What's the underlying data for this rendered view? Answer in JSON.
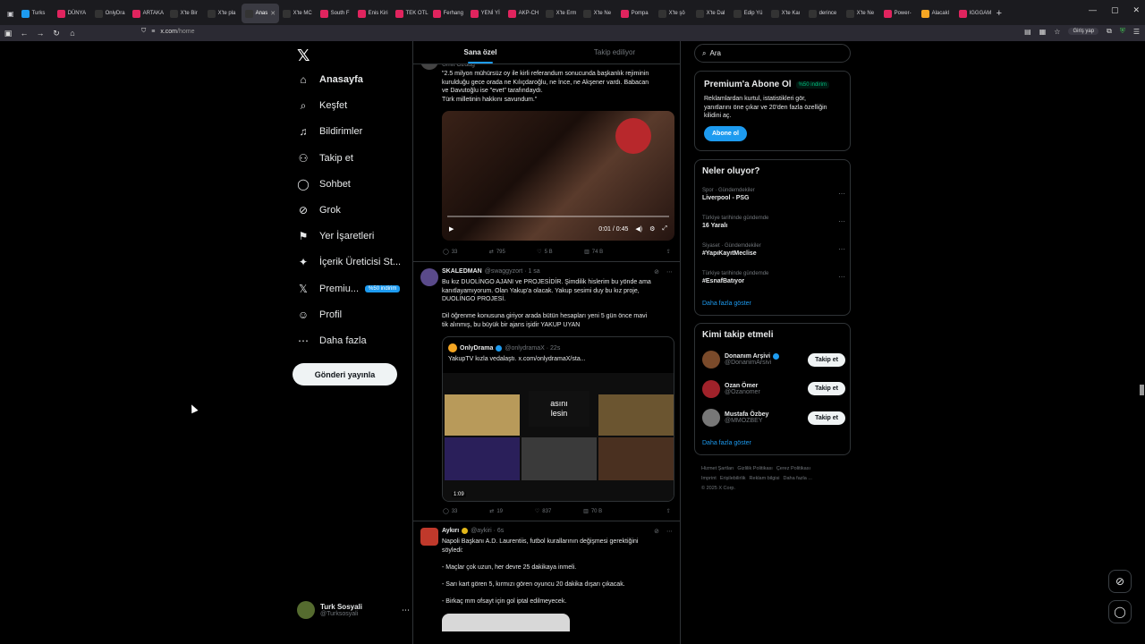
{
  "browser": {
    "tabs": [
      {
        "label": "Turks",
        "color": "#1d9bf0",
        "active": false
      },
      {
        "label": "DÜNYA",
        "color": "#e0245e",
        "active": false
      },
      {
        "label": "OnlyDra",
        "color": "#333",
        "active": false
      },
      {
        "label": "ARTAKA",
        "color": "#e0245e",
        "active": false
      },
      {
        "label": "X'te Bir",
        "color": "#333",
        "active": false
      },
      {
        "label": "X'te pla",
        "color": "#333",
        "active": false
      },
      {
        "label": "Anas",
        "color": "#333",
        "active": true
      },
      {
        "label": "X'te MC",
        "color": "#333",
        "active": false
      },
      {
        "label": "South F",
        "color": "#e0245e",
        "active": false
      },
      {
        "label": "Enis Kiri",
        "color": "#e0245e",
        "active": false
      },
      {
        "label": "TEK OTL",
        "color": "#e0245e",
        "active": false
      },
      {
        "label": "Ferhang",
        "color": "#e0245e",
        "active": false
      },
      {
        "label": "YENİ Yİ",
        "color": "#e0245e",
        "active": false
      },
      {
        "label": "AKP-CH",
        "color": "#e0245e",
        "active": false
      },
      {
        "label": "X'te Erm",
        "color": "#333",
        "active": false
      },
      {
        "label": "X'te Ne",
        "color": "#333",
        "active": false
      },
      {
        "label": "Pompa",
        "color": "#e0245e",
        "active": false
      },
      {
        "label": "X'te şö",
        "color": "#333",
        "active": false
      },
      {
        "label": "X'te Dal",
        "color": "#333",
        "active": false
      },
      {
        "label": "Edip Yü",
        "color": "#333",
        "active": false
      },
      {
        "label": "X'te Kaı",
        "color": "#333",
        "active": false
      },
      {
        "label": "derince",
        "color": "#333",
        "active": false
      },
      {
        "label": "X'te Ne",
        "color": "#333",
        "active": false
      },
      {
        "label": "Power-",
        "color": "#e0245e",
        "active": false
      },
      {
        "label": "Alacakl",
        "color": "#f5a623",
        "active": false
      },
      {
        "label": "IGGGAM",
        "color": "#e0245e",
        "active": false
      }
    ],
    "url_domain": "x.com",
    "url_path": "/home",
    "signin_label": "Giriş yap"
  },
  "nav": {
    "items": [
      {
        "label": "Anasayfa",
        "icon": "home-icon",
        "glyph": "⌂",
        "bold": true
      },
      {
        "label": "Keşfet",
        "icon": "search-icon",
        "glyph": "⌕",
        "bold": false
      },
      {
        "label": "Bildirimler",
        "icon": "bell-icon",
        "glyph": "♫",
        "bold": false
      },
      {
        "label": "Takip et",
        "icon": "follow-icon",
        "glyph": "⚇",
        "bold": false
      },
      {
        "label": "Sohbet",
        "icon": "chat-icon",
        "glyph": "◯",
        "bold": false
      },
      {
        "label": "Grok",
        "icon": "grok-icon",
        "glyph": "⊘",
        "bold": false
      },
      {
        "label": "Yer İşaretleri",
        "icon": "bookmark-icon",
        "glyph": "⚑",
        "bold": false
      },
      {
        "label": "İçerik Üreticisi St...",
        "icon": "lightning-icon",
        "glyph": "✦",
        "bold": false
      },
      {
        "label": "Premiu...",
        "icon": "x-icon",
        "glyph": "𝕏",
        "bold": false
      },
      {
        "label": "Profil",
        "icon": "profile-icon",
        "glyph": "☺",
        "bold": false
      },
      {
        "label": "Daha fazla",
        "icon": "more-icon",
        "glyph": "⋯",
        "bold": false
      }
    ],
    "premium_badge": "%50 indirim",
    "post_button": "Gönderi yayınla",
    "profile_name": "Turk Sosyali",
    "profile_handle": "@Turksosyali"
  },
  "feed": {
    "tabs": [
      "Sana özel",
      "Takip ediliyor"
    ],
    "tweet1": {
      "author_partial": "Ümit Özdağ",
      "text_lines": [
        "\"2.5 milyon mühürsüz oy ile kirli referandum sonucunda başkanlık rejiminin",
        "kurulduğu  gece orada ne Kılıçdaroğlu, ne İnce, ne Akşener vardı. Babacan",
        "ve Davutoğlu ise \"evet\" tarafındaydı.",
        "Türk milletinin hakkını savundum.\""
      ],
      "video_time": "0:01 / 0:45",
      "stats": {
        "replies": "33",
        "reposts": "795",
        "likes": "5 B",
        "views": "74 B"
      }
    },
    "tweet2": {
      "name": "SKALEDMAN",
      "handle": "@swaggyzort · 1 sa",
      "text_lines": [
        "Bu kız DUOLİNGO AJANI ve PROJESİDİR. Şimdilik hislerim bu yönde ama",
        "kanıtlayamıyorum. Olan Yakup'a olacak. Yakup sesimi duy bu kız proje,",
        "DUOLİNGO PROJESİ.",
        "",
        "Dil öğrenme konusuna giriyor arada bütün hesapları yeni 5 gün önce mavi",
        "tik alınmış, bu büyük bir ajans işidir YAKUP UYAN"
      ],
      "quote": {
        "name": "OnlyDrama",
        "handle": "@onlydramaX · 22s",
        "text": "YakupTV kızla vedalaştı.  x.com/onlydramaX/sta...",
        "overlay_line1": "asını",
        "overlay_line2": "lesin",
        "duration": "1:09"
      },
      "stats": {
        "replies": "33",
        "reposts": "19",
        "likes": "837",
        "views": "70 B"
      }
    },
    "tweet3": {
      "name": "Aykırı",
      "handle": "@aykiri · 6s",
      "text_lines": [
        "Napoli Başkanı A.D. Laurentiis, futbol kurallarının değişmesi gerektiğini",
        "söyledi:",
        "",
        "- Maçlar çok uzun, her devre 25 dakikaya inmeli.",
        "",
        "- Sarı kart gören 5, kırmızı gören oyuncu 20 dakika dışarı çıkacak.",
        "",
        "- Birkaç mm ofsayt için gol iptal edilmeyecek."
      ]
    }
  },
  "sidebar": {
    "search_placeholder": "Ara",
    "premium": {
      "title": "Premium'a Abone Ol",
      "tag": "%50 indirim",
      "body_lines": [
        "Reklamlardan kurtul, istatistikleri gör,",
        "yanıtlarını öne çıkar ve 20'den fazla özelliğin",
        "kilidini aç."
      ],
      "button": "Abone ol"
    },
    "trends": {
      "title": "Neler oluyor?",
      "items": [
        {
          "category": "Spor · Gündemdekiler",
          "name": "Liverpool - PSG"
        },
        {
          "category": "Türkiye tarihinde gündemde",
          "name": "16 Yaralı"
        },
        {
          "category": "Siyaset · Gündemdekiler",
          "name": "#YapıKayıtMeclise"
        },
        {
          "category": "Türkiye tarihinde gündemde",
          "name": "#EsnafBatıyor"
        }
      ],
      "more": "Daha fazla göster"
    },
    "who_to_follow": {
      "title": "Kimi takip etmeli",
      "items": [
        {
          "name": "Donanım Arşivi",
          "handle": "@DonanimArsivi",
          "verified": true,
          "color": "#7a4a2a"
        },
        {
          "name": "Ozan Ömer",
          "handle": "@Ozanomer",
          "verified": false,
          "color": "#a0222a"
        },
        {
          "name": "Mustafa Özbey",
          "handle": "@MMOZBEY",
          "verified": false,
          "color": "#777"
        }
      ],
      "follow_label": "Takip et",
      "more": "Daha fazla göster"
    },
    "footer": [
      "Hizmet Şartları",
      "Gizlilik Politikası",
      "Çerez Politikası",
      "Imprint",
      "Erişilebilirlik",
      "Reklam bilgisi",
      "Daha fazla ...",
      "© 2025 X Corp."
    ]
  }
}
